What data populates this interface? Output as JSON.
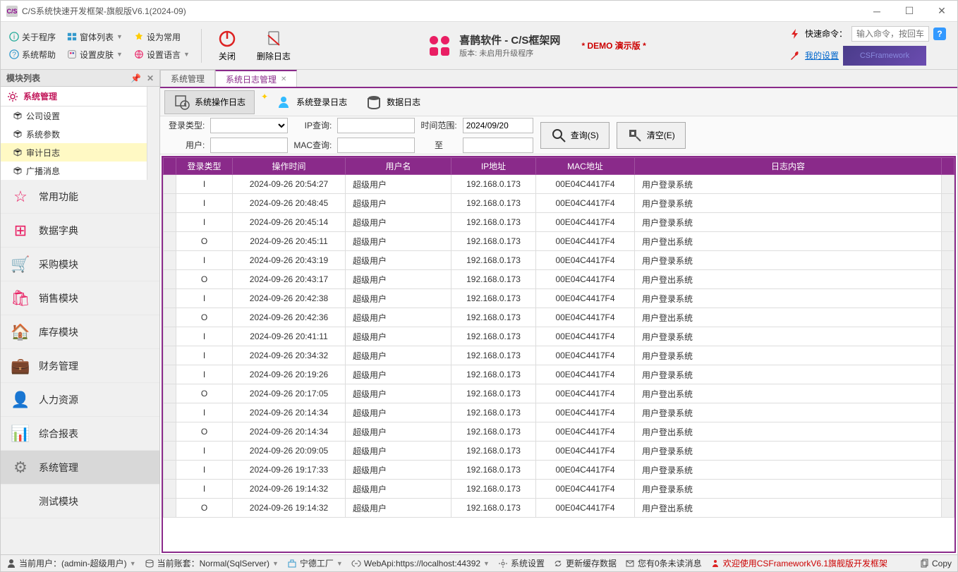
{
  "window": {
    "title": "C/S系统快速开发框架-旗舰版V6.1(2024-09)",
    "icon_text": "C/S"
  },
  "ribbon": {
    "col1": [
      {
        "label": "关于程序"
      },
      {
        "label": "系统帮助"
      }
    ],
    "col2": [
      {
        "label": "窗体列表"
      },
      {
        "label": "设置皮肤"
      }
    ],
    "col3": [
      {
        "label": "设为常用"
      },
      {
        "label": "设置语言"
      }
    ],
    "close": "关闭",
    "delete_log": "删除日志",
    "brand_title": "喜鹊软件 - C/S框架网",
    "brand_sub": "版本: 未启用升级程序",
    "demo": "* DEMO 演示版 *",
    "quick_cmd": "快速命令：",
    "cmd_placeholder": "输入命令，按回车",
    "my_settings": "我的设置",
    "csf": "CSFramework"
  },
  "sidebar": {
    "header": "模块列表",
    "category": "系统管理",
    "tree": [
      {
        "label": "公司设置"
      },
      {
        "label": "系统参数"
      },
      {
        "label": "审计日志",
        "active": true
      },
      {
        "label": "广播消息"
      }
    ],
    "modules": [
      {
        "label": "常用功能",
        "color": "#e91e63"
      },
      {
        "label": "数据字典",
        "color": "#e91e63"
      },
      {
        "label": "采购模块",
        "color": "#e91e63"
      },
      {
        "label": "销售模块",
        "color": "#e91e63"
      },
      {
        "label": "库存模块",
        "color": "#e91e63"
      },
      {
        "label": "财务管理",
        "color": "#e91e63"
      },
      {
        "label": "人力资源",
        "color": "#e91e63"
      },
      {
        "label": "综合报表",
        "color": "#e91e63"
      },
      {
        "label": "系统管理",
        "color": "#777",
        "active": true
      },
      {
        "label": "测试模块",
        "color": "#e91e63"
      }
    ]
  },
  "tabs": [
    {
      "label": "系统管理"
    },
    {
      "label": "系统日志管理",
      "active": true,
      "closable": true
    }
  ],
  "subtabs": [
    {
      "label": "系统操作日志",
      "active": true
    },
    {
      "label": "系统登录日志"
    },
    {
      "label": "数据日志"
    }
  ],
  "filters": {
    "login_type_lbl": "登录类型:",
    "user_lbl": "用户:",
    "ip_lbl": "IP查询:",
    "mac_lbl": "MAC查询:",
    "time_lbl": "时间范围:",
    "date_from": "2024/09/20",
    "to": "至",
    "search": "查询(S)",
    "clear": "清空(E)"
  },
  "grid": {
    "cols": [
      "登录类型",
      "操作时间",
      "用户名",
      "IP地址",
      "MAC地址",
      "日志内容"
    ],
    "rows": [
      [
        "I",
        "2024-09-26 20:54:27",
        "超级用户",
        "192.168.0.173",
        "00E04C4417F4",
        "用户登录系统"
      ],
      [
        "I",
        "2024-09-26 20:48:45",
        "超级用户",
        "192.168.0.173",
        "00E04C4417F4",
        "用户登录系统"
      ],
      [
        "I",
        "2024-09-26 20:45:14",
        "超级用户",
        "192.168.0.173",
        "00E04C4417F4",
        "用户登录系统"
      ],
      [
        "O",
        "2024-09-26 20:45:11",
        "超级用户",
        "192.168.0.173",
        "00E04C4417F4",
        "用户登出系统"
      ],
      [
        "I",
        "2024-09-26 20:43:19",
        "超级用户",
        "192.168.0.173",
        "00E04C4417F4",
        "用户登录系统"
      ],
      [
        "O",
        "2024-09-26 20:43:17",
        "超级用户",
        "192.168.0.173",
        "00E04C4417F4",
        "用户登出系统"
      ],
      [
        "I",
        "2024-09-26 20:42:38",
        "超级用户",
        "192.168.0.173",
        "00E04C4417F4",
        "用户登录系统"
      ],
      [
        "O",
        "2024-09-26 20:42:36",
        "超级用户",
        "192.168.0.173",
        "00E04C4417F4",
        "用户登出系统"
      ],
      [
        "I",
        "2024-09-26 20:41:11",
        "超级用户",
        "192.168.0.173",
        "00E04C4417F4",
        "用户登录系统"
      ],
      [
        "I",
        "2024-09-26 20:34:32",
        "超级用户",
        "192.168.0.173",
        "00E04C4417F4",
        "用户登录系统"
      ],
      [
        "I",
        "2024-09-26 20:19:26",
        "超级用户",
        "192.168.0.173",
        "00E04C4417F4",
        "用户登录系统"
      ],
      [
        "O",
        "2024-09-26 20:17:05",
        "超级用户",
        "192.168.0.173",
        "00E04C4417F4",
        "用户登出系统"
      ],
      [
        "I",
        "2024-09-26 20:14:34",
        "超级用户",
        "192.168.0.173",
        "00E04C4417F4",
        "用户登录系统"
      ],
      [
        "O",
        "2024-09-26 20:14:34",
        "超级用户",
        "192.168.0.173",
        "00E04C4417F4",
        "用户登出系统"
      ],
      [
        "I",
        "2024-09-26 20:09:05",
        "超级用户",
        "192.168.0.173",
        "00E04C4417F4",
        "用户登录系统"
      ],
      [
        "I",
        "2024-09-26 19:17:33",
        "超级用户",
        "192.168.0.173",
        "00E04C4417F4",
        "用户登录系统"
      ],
      [
        "I",
        "2024-09-26 19:14:32",
        "超级用户",
        "192.168.0.173",
        "00E04C4417F4",
        "用户登录系统"
      ],
      [
        "O",
        "2024-09-26 19:14:32",
        "超级用户",
        "192.168.0.173",
        "00E04C4417F4",
        "用户登出系统"
      ]
    ]
  },
  "status": {
    "user": "当前用户：(admin-超级用户)",
    "account": "当前账套：Normal(SqlServer)",
    "factory": "宁德工厂",
    "webapi": "WebApi:https://localhost:44392",
    "settings": "系统设置",
    "refresh": "更新缓存数据",
    "unread": "您有0条未读消息",
    "welcome": "欢迎使用CSFrameworkV6.1旗舰版开发框架",
    "copy": "Copy"
  }
}
